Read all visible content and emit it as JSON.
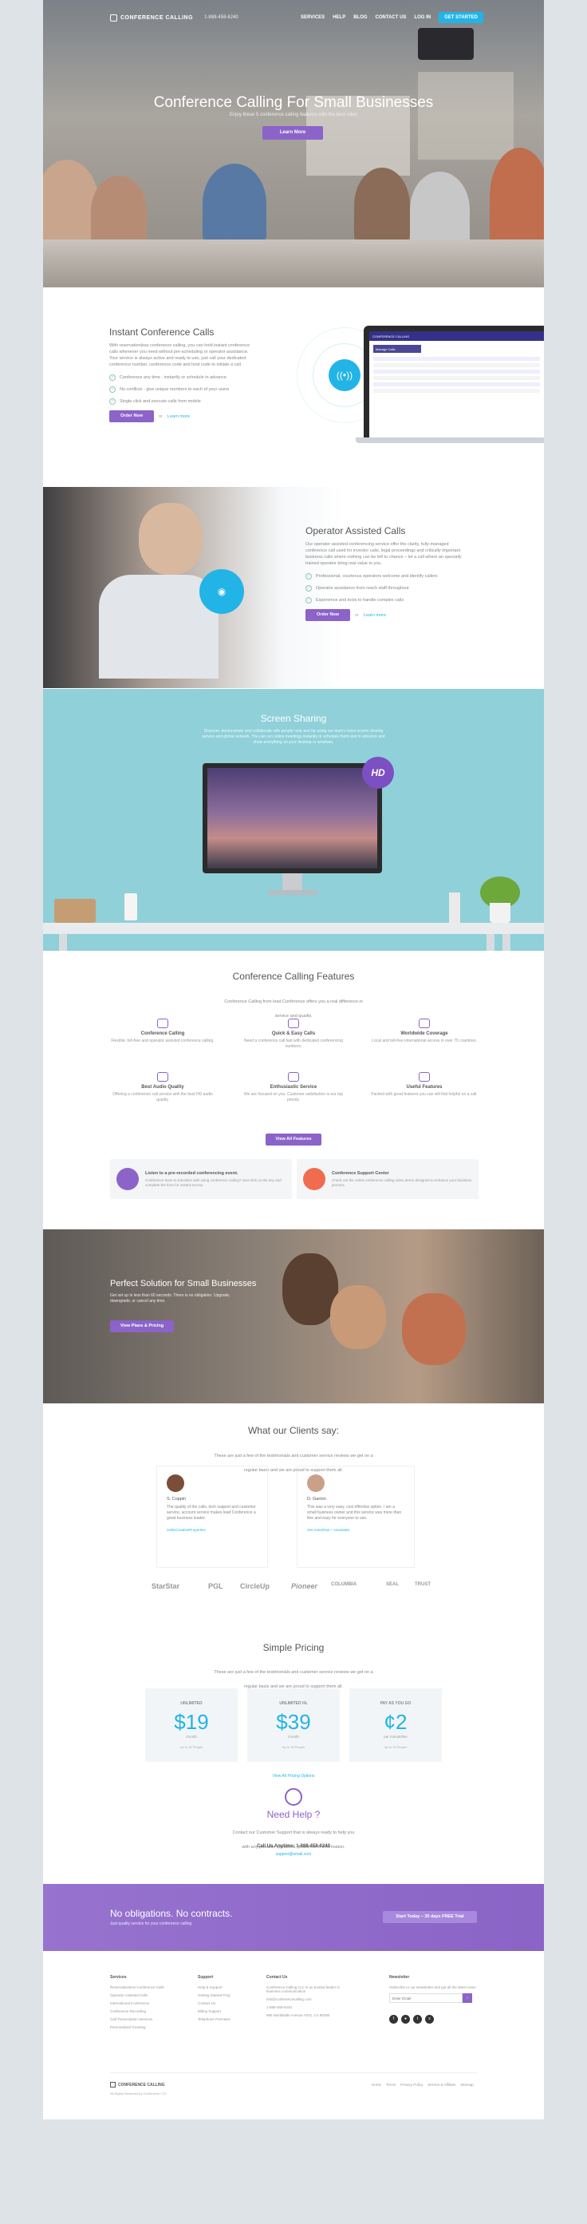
{
  "nav": {
    "logo": "CONFERENCE CALLING",
    "phone": "1-888-458-6240",
    "links": [
      "SERVICES",
      "HELP",
      "BLOG",
      "CONTACT US",
      "LOG IN"
    ],
    "cta": "GET STARTED"
  },
  "hero": {
    "title": "Conference Calling For Small Businesses",
    "subtitle": "Enjoy these 5 conference calling features with the best rates",
    "button": "Learn More"
  },
  "instant": {
    "title": "Instant Conference Calls",
    "text": "With reservationless conference calling, you can hold instant conference calls whenever you need without pre-scheduling or operator assistance. Your service is always active and ready to use, just call your dedicated conference number, conference code and host code to initiate a call.",
    "bullets": [
      "Conference any time - instantly or schedule in advance",
      "No conflicts - give unique numbers to each of your users",
      "Single click and execute calls from mobile"
    ],
    "button": "Order Now",
    "or": "or",
    "learn": "Learn more",
    "laptop_brand": "CONFERENCE CALLING",
    "laptop_panel": "Manage Calls"
  },
  "operator": {
    "title": "Operator Assisted Calls",
    "text": "Our operator assisted conferencing service offer the clarity, fully-managed conference call used for investor calls, legal proceedings and critically important business calls where nothing can be left to chance – let a call where an specially trained operator bring real value to you.",
    "bullets": [
      "Professional, courteous operators welcome and identify callers",
      "Operator assistance from reach staff throughout",
      "Experience and tools to handle complex calls"
    ],
    "button": "Order Now",
    "or": "or",
    "learn": "Learn more"
  },
  "screen": {
    "title": "Screen Sharing",
    "text": "Discover, demonstrate and collaborate with people near and far using our team’s most screen sharing service and global network. You can run online meetings instantly or schedule them and in advance and show everything on your desktop or windows.",
    "badge": "HD"
  },
  "features": {
    "title": "Conference Calling Features",
    "subtitle": "Conference Calling from lead Conference offers you a real difference in service and quality.",
    "items": [
      {
        "title": "Conference Calling",
        "desc": "Flexible, toll-free and operator assisted conference calling."
      },
      {
        "title": "Quick & Easy Calls",
        "desc": "Need a conference call fast with dedicated conferencing numbers."
      },
      {
        "title": "Worldwide Coverage",
        "desc": "Local and toll-free international access in over 70 countries."
      },
      {
        "title": "Best Audio Quality",
        "desc": "Offering a conference call service with the best HD audio quality."
      },
      {
        "title": "Enthusiastic Service",
        "desc": "We are focused on you. Customer satisfaction is our top priority."
      },
      {
        "title": "Useful Features",
        "desc": "Packed with great features you can will find helpful on a call."
      }
    ],
    "button": "View All Features",
    "cards": [
      {
        "title": "Listen to a pre-recorded conferencing event.",
        "desc": "Conference team to transition with using conference calling? Just click on the key and complete the form for instant access."
      },
      {
        "title": "Conference Support Center",
        "desc": "Check out the online conference calling video demo designed to enhance your business process."
      }
    ]
  },
  "perfect": {
    "title": "Perfect Solution for Small Businesses",
    "text": "Get set up in less than 60 seconds. There is no obligation. Upgrade, downgrade, or cancel any time.",
    "button": "View Plans & Pricing"
  },
  "clients": {
    "title": "What our Clients say:",
    "subtitle": "These are just a few of the testimonials and customer service reviews we get on a regular basis and we are proud to support them all.",
    "items": [
      {
        "name": "S. Coppin",
        "quote": "The quality of the calls, tech support and customer service, account service makes lead Conference a great business leader.",
        "link": "SollerCreativeProperties"
      },
      {
        "name": "D. Garton",
        "quote": "This was a very easy, cost effective option. I am a small business owner and this service was more than fine and easy for everyone to use.",
        "link": "SSI AutoShop + AutoSales"
      }
    ],
    "partners": [
      "StarStar",
      "PGL",
      "CircleUp",
      "Pioneer",
      "COLUMBIA",
      "SEAL",
      "TRUST"
    ]
  },
  "pricing": {
    "title": "Simple Pricing",
    "subtitle": "These are just a few of the testimonials and customer service reviews we get on a regular basis and we are proud to support them all.",
    "plans": [
      {
        "label": "UNLIMITED",
        "price": "$19",
        "unit": "/month",
        "note": "Up to 25 People"
      },
      {
        "label": "UNLIMITED HL",
        "price": "$39",
        "unit": "/month",
        "note": "Up to 25 People"
      },
      {
        "label": "PAY AS YOU GO",
        "price": "¢2",
        "unit": "per minute/line",
        "note": "Up to 25 People"
      }
    ],
    "link": "View All Pricing Options"
  },
  "help": {
    "title": "Need Help ?",
    "text": "Contact our Customer Support that is always ready to help you with any possible questions, problems or information.",
    "call": "Call Us Anytime: 1-888-458-6240",
    "email": "support@email.com"
  },
  "cta": {
    "title": "No obligations. No contracts.",
    "subtitle": "Just quality service for your conference calling",
    "button": "Start Today – 30 days FREE Trial"
  },
  "footer": {
    "columns": [
      {
        "heading": "Services",
        "items": [
          "Reservationless Conference Calls",
          "Operator Assisted Calls",
          "International Conference",
          "Conference Recording",
          "Call Transcription Services",
          "Personalized Greeting"
        ]
      },
      {
        "heading": "Support",
        "items": [
          "Help & Support",
          "Getting Started FAQ",
          "Contact Us",
          "Billing Support",
          "Telephone Premises"
        ]
      },
      {
        "heading": "Contact Us",
        "items": [
          "Conference Calling LLC is an trusted leader in business communication",
          "info@conferencecalling.com",
          "1-888-458-6240",
          "999 Worldwide Avenue #201, CA 90280"
        ]
      },
      {
        "heading": "Newsletter",
        "items": [
          "Subscribe to our Newsletter and get all the latest news"
        ]
      }
    ],
    "email_placeholder": "Enter Email",
    "logo": "CONFERENCE CALLING",
    "copyright": "All Rights Reserved by Conference LTD",
    "links": [
      "Home",
      "Terms",
      "Privacy Policy",
      "Service & Affiliate",
      "Sitemap"
    ]
  }
}
